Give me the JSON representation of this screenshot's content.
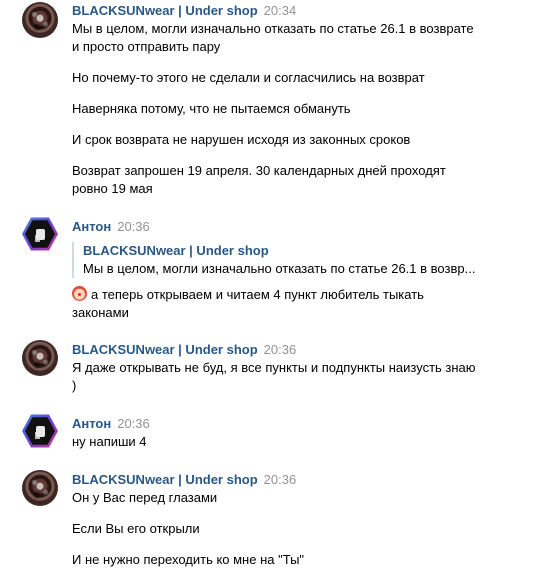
{
  "messages": [
    {
      "author": "BLACKSUNwear | Under shop",
      "time": "20:34",
      "lines": [
        "Мы в целом, могли изначально отказать по статье 26.1 в возврате",
        "и просто отправить пару",
        "Но почему-то этого не сделали и согласчились на возврат",
        "Наверняка потому, что не пытаемся обмануть",
        "И срок возврата не нарушен исходя из законных сроков",
        "Возврат запрошен 19 апреля. 30 календарных дней проходят",
        "ровно 19 мая"
      ]
    },
    {
      "author": "Антон",
      "time": "20:36",
      "quote_author": "BLACKSUNwear | Under shop",
      "quote_text": "Мы в целом, могли изначально отказать по статье 26.1 в возвр...",
      "lines": [
        "а теперь открываем и читаем 4 пункт любитель тыкать",
        "законами"
      ],
      "emoji": "clown-face-emoji"
    },
    {
      "author": "BLACKSUNwear | Under shop",
      "time": "20:36",
      "lines": [
        "Я даже открывать не буд, я все пункты и подпункты наизусть знаю",
        ")"
      ]
    },
    {
      "author": "Антон",
      "time": "20:36",
      "lines": [
        "ну напиши 4"
      ]
    },
    {
      "author": "BLACKSUNwear | Under shop",
      "time": "20:36",
      "lines": [
        "Он у Вас перед глазами",
        "Если Вы его открыли",
        "И не нужно переходить ко мне на \"Ты\""
      ]
    }
  ],
  "colors": {
    "author": "#2a5885",
    "time": "#939393",
    "text": "#000000",
    "quote_border": "#cfd9e3"
  }
}
